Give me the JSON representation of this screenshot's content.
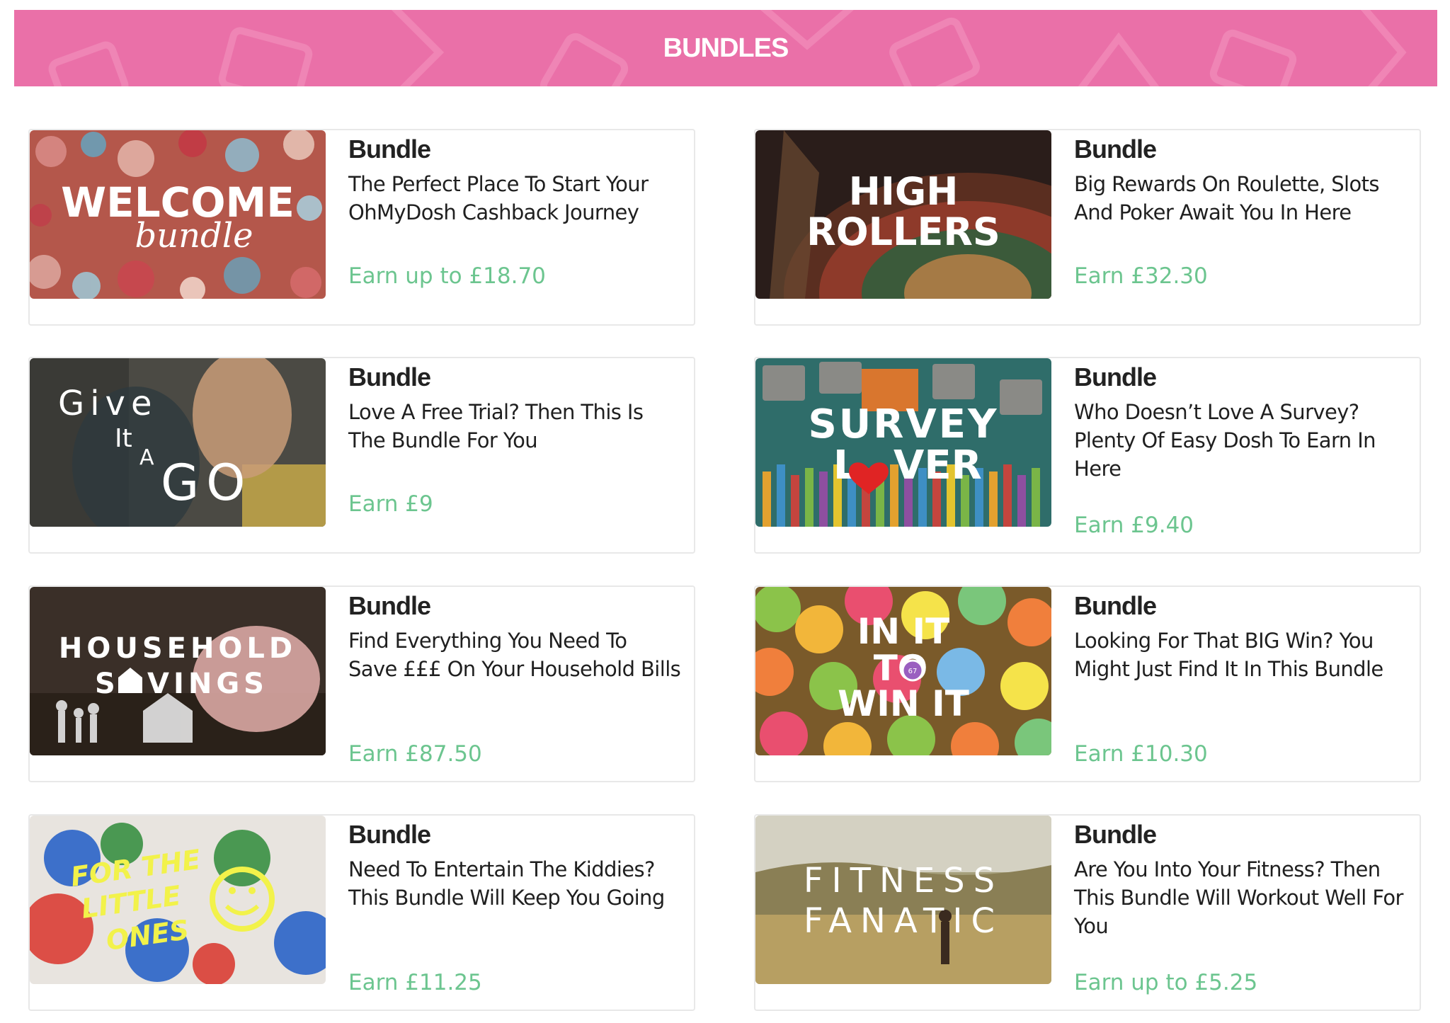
{
  "header": {
    "title": "BUNDLES"
  },
  "bundles": [
    {
      "image": {
        "title": "WELCOME",
        "subtitle": "bundle"
      },
      "kicker": "Bundle",
      "description": "The Perfect Place To Start Your OhMyDosh Cashback Journey",
      "earn": "Earn up to £18.70"
    },
    {
      "image": {
        "line1": "HIGH",
        "line2": "ROLLERS"
      },
      "kicker": "Bundle",
      "description": "Big Rewards On Roulette, Slots And Poker Await You In Here",
      "earn": "Earn £32.30"
    },
    {
      "image": {
        "w1": "Give",
        "w2": "It",
        "w3": "A",
        "w4": "GO"
      },
      "kicker": "Bundle",
      "description": "Love A Free Trial? Then This Is The Bundle For You",
      "earn": "Earn £9"
    },
    {
      "image": {
        "line1": "SURVEY",
        "line2_a": "L",
        "line2_b": "VER"
      },
      "kicker": "Bundle",
      "description": "Who Doesn’t Love A Survey? Plenty Of Easy Dosh To Earn In Here",
      "earn": "Earn £9.40"
    },
    {
      "image": {
        "line1": "HOUSEHOLD",
        "line2_a": "S",
        "line2_b": "VINGS"
      },
      "kicker": "Bundle",
      "description": "Find Everything You Need To Save £££ On Your Household Bills",
      "earn": "Earn £87.50"
    },
    {
      "image": {
        "line1": "IN IT",
        "line2": "TO",
        "line3": "WIN IT",
        "ball_number": "67"
      },
      "kicker": "Bundle",
      "description": "Looking For That BIG Win? You Might Just Find It In This Bundle",
      "earn": "Earn £10.30"
    },
    {
      "image": {
        "line1": "FOR THE",
        "line2": "LITTLE",
        "line3": "ONES"
      },
      "kicker": "Bundle",
      "description": "Need To Entertain The Kiddies? This Bundle Will Keep You Going",
      "earn": "Earn £11.25"
    },
    {
      "image": {
        "line1": "FITNESS",
        "line2": "FANATIC"
      },
      "kicker": "Bundle",
      "description": "Are You Into Your Fitness? Then This Bundle Will Workout Well For You",
      "earn": "Earn up to £5.25"
    }
  ]
}
